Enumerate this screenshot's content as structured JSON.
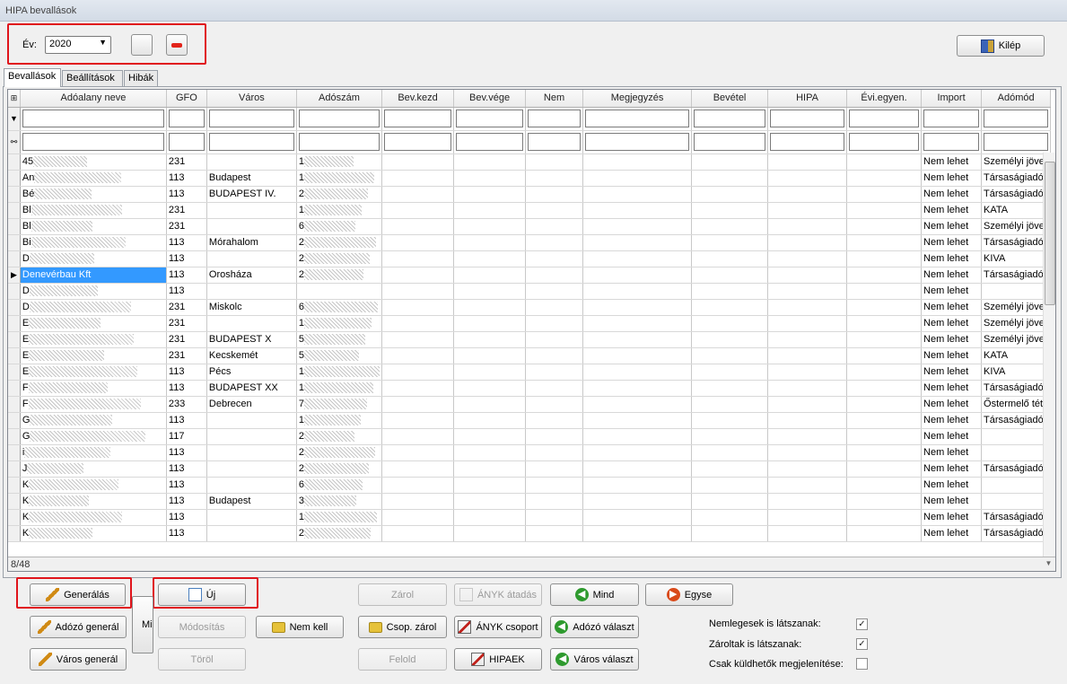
{
  "window": {
    "title": "HIPA bevallások"
  },
  "toolbar": {
    "year_label": "Év:",
    "year_value": "2020",
    "exit_label": "Kilép"
  },
  "tabs": [
    "Bevallások",
    "Beállítások",
    "Hibák"
  ],
  "grid": {
    "columns": [
      "Adóalany neve",
      "GFO",
      "Város",
      "Adószám",
      "Bev.kezd",
      "Bev.vége",
      "Nem",
      "Megjegyzés",
      "Bevétel",
      "HIPA",
      "Évi.egyen.",
      "Import",
      "Adómód"
    ],
    "rows": [
      {
        "name": "45",
        "gfo": "231",
        "varos": "",
        "adoszam": "1",
        "import": "Nem lehet",
        "adomod": "Személyi jöve"
      },
      {
        "name": "An",
        "gfo": "113",
        "varos": "Budapest",
        "adoszam": "1",
        "import": "Nem lehet",
        "adomod": "Társaságiadó"
      },
      {
        "name": "Bé",
        "gfo": "113",
        "varos": "BUDAPEST IV.",
        "adoszam": "2",
        "import": "Nem lehet",
        "adomod": "Társaságiadó"
      },
      {
        "name": "Bl",
        "gfo": "231",
        "varos": "",
        "adoszam": "1",
        "import": "Nem lehet",
        "adomod": "KATA"
      },
      {
        "name": "Bl",
        "gfo": "231",
        "varos": "",
        "adoszam": "6",
        "import": "Nem lehet",
        "adomod": "Személyi jöve"
      },
      {
        "name": "Bi",
        "gfo": "113",
        "varos": "Mórahalom",
        "adoszam": "2",
        "import": "Nem lehet",
        "adomod": "Társaságiadó"
      },
      {
        "name": "D",
        "gfo": "113",
        "varos": "",
        "adoszam": "2",
        "import": "Nem lehet",
        "adomod": "KIVA"
      },
      {
        "name": "Denevérbau Kft",
        "gfo": "113",
        "varos": "Orosháza",
        "adoszam": "2",
        "import": "Nem lehet",
        "adomod": "Társaságiadó",
        "selected": true
      },
      {
        "name": "D",
        "gfo": "113",
        "varos": "",
        "adoszam": "",
        "import": "Nem lehet",
        "adomod": ""
      },
      {
        "name": "D",
        "gfo": "231",
        "varos": "Miskolc",
        "adoszam": "6",
        "import": "Nem lehet",
        "adomod": "Személyi jöve"
      },
      {
        "name": "E",
        "gfo": "231",
        "varos": "",
        "adoszam": "1",
        "import": "Nem lehet",
        "adomod": "Személyi jöve"
      },
      {
        "name": "E",
        "gfo": "231",
        "varos": "BUDAPEST X",
        "adoszam": "5",
        "import": "Nem lehet",
        "adomod": "Személyi jöve"
      },
      {
        "name": "E",
        "gfo": "231",
        "varos": "Kecskemét",
        "adoszam": "5",
        "import": "Nem lehet",
        "adomod": "KATA"
      },
      {
        "name": "E",
        "gfo": "113",
        "varos": "Pécs",
        "adoszam": "1",
        "import": "Nem lehet",
        "adomod": "KIVA"
      },
      {
        "name": "F",
        "gfo": "113",
        "varos": "BUDAPEST XX",
        "adoszam": "1",
        "import": "Nem lehet",
        "adomod": "Társaságiadó"
      },
      {
        "name": "F",
        "gfo": "233",
        "varos": "Debrecen",
        "adoszam": "7",
        "import": "Nem lehet",
        "adomod": "Őstermelő téte"
      },
      {
        "name": "G",
        "gfo": "113",
        "varos": "",
        "adoszam": "1",
        "import": "Nem lehet",
        "adomod": "Társaságiadó"
      },
      {
        "name": "G",
        "gfo": "117",
        "varos": "",
        "adoszam": "2",
        "import": "Nem lehet",
        "adomod": ""
      },
      {
        "name": "i",
        "gfo": "113",
        "varos": "",
        "adoszam": "2",
        "import": "Nem lehet",
        "adomod": ""
      },
      {
        "name": "J",
        "gfo": "113",
        "varos": "",
        "adoszam": "2",
        "import": "Nem lehet",
        "adomod": "Társaságiadó"
      },
      {
        "name": "K",
        "gfo": "113",
        "varos": "",
        "adoszam": "6",
        "import": "Nem lehet",
        "adomod": ""
      },
      {
        "name": "K",
        "gfo": "113",
        "varos": "Budapest",
        "adoszam": "3",
        "import": "Nem lehet",
        "adomod": ""
      },
      {
        "name": "K",
        "gfo": "113",
        "varos": "",
        "adoszam": "1",
        "import": "Nem lehet",
        "adomod": "Társaságiadó"
      },
      {
        "name": "K",
        "gfo": "113",
        "varos": "",
        "adoszam": "2",
        "import": "Nem lehet",
        "adomod": "Társaságiadó"
      }
    ],
    "status": "8/48"
  },
  "buttons": {
    "generalas": "Generálás",
    "uj": "Új",
    "zarol": "Zárol",
    "anyk_atadas": "ÁNYK átadás",
    "mind": "Mind",
    "egyse": "Egyse",
    "adozo_general": "Adózó generál",
    "mi": "Mi",
    "modositas": "Módosítás",
    "nem_kell": "Nem kell",
    "csop_zarol": "Csop. zárol",
    "anyk_csoport": "ÁNYK csoport",
    "adozo_valaszt": "Adózó választ",
    "varos_general": "Város generál",
    "torol": "Töröl",
    "felold": "Felold",
    "hipaek": "HIPAEK",
    "varos_valaszt": "Város választ"
  },
  "options": {
    "nemlegesek_label": "Nemlegesek is látszanak:",
    "nemlegesek_checked": true,
    "zaroltak_label": "Zároltak is látszanak:",
    "zaroltak_checked": true,
    "csak_kuldheto_label": "Csak küldhetők megjelenítése:",
    "csak_kuldheto_checked": false
  }
}
